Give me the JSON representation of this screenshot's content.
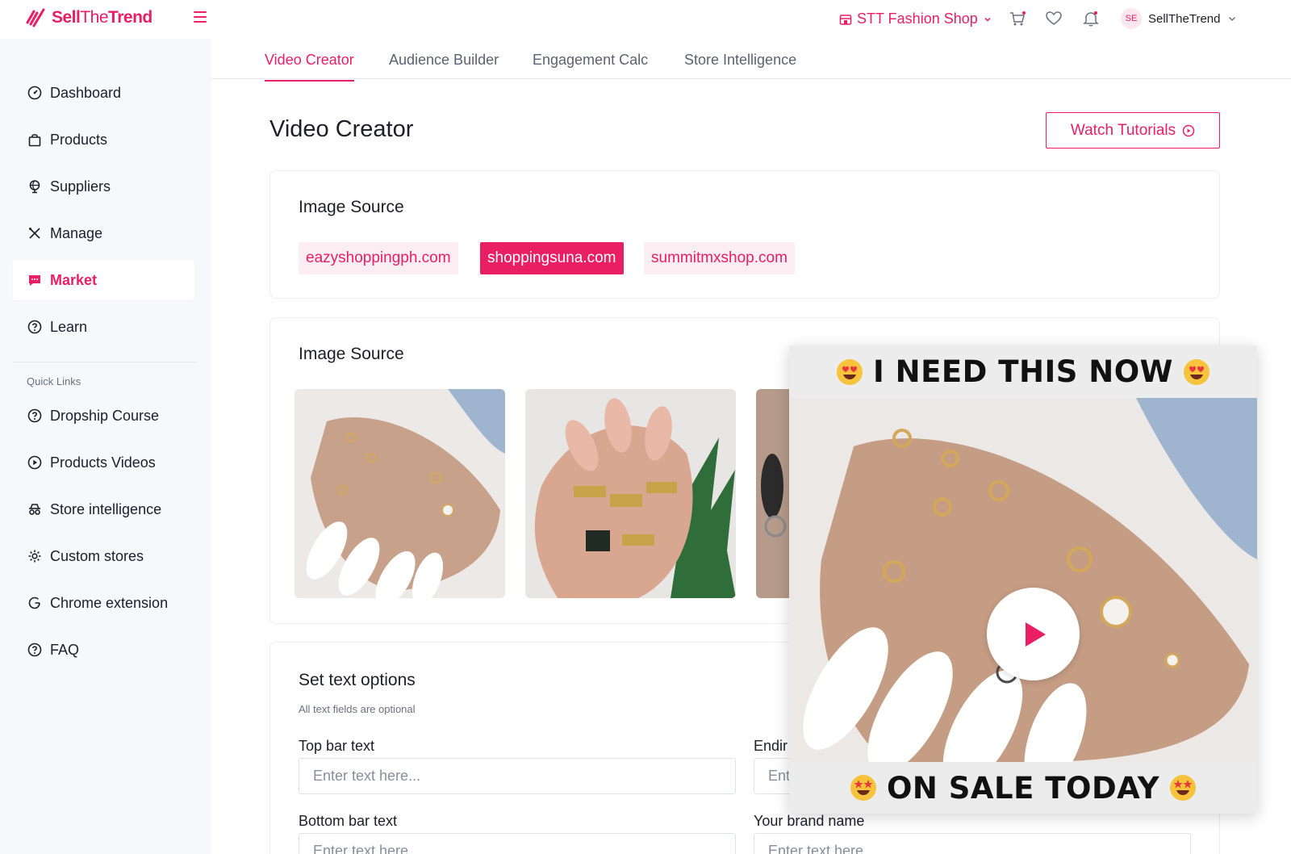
{
  "brand": {
    "logo_text_bold": "Sell",
    "logo_text_light": "The",
    "logo_text_end": "Trend",
    "accent": "#e91e63"
  },
  "sidebar": {
    "items": [
      {
        "label": "Dashboard",
        "icon": "dashboard-icon"
      },
      {
        "label": "Products",
        "icon": "bag-icon"
      },
      {
        "label": "Suppliers",
        "icon": "globe-icon"
      },
      {
        "label": "Manage",
        "icon": "tools-icon"
      },
      {
        "label": "Market",
        "icon": "chat-icon",
        "active": true
      },
      {
        "label": "Learn",
        "icon": "help-circle-icon"
      }
    ],
    "quick_links_label": "Quick Links",
    "quick_links": [
      {
        "label": "Dropship Course",
        "icon": "help-circle-icon"
      },
      {
        "label": "Products Videos",
        "icon": "play-circle-icon"
      },
      {
        "label": "Store intelligence",
        "icon": "spy-icon"
      },
      {
        "label": "Custom stores",
        "icon": "gear-icon"
      },
      {
        "label": "Chrome extension",
        "icon": "google-icon"
      },
      {
        "label": "FAQ",
        "icon": "help-circle-icon"
      }
    ]
  },
  "topbar": {
    "shop_label": "STT Fashion Shop",
    "user_initials": "SE",
    "user_name": "SellTheTrend"
  },
  "tabs": [
    {
      "label": "Video Creator",
      "active": true
    },
    {
      "label": "Audience Builder"
    },
    {
      "label": "Engagement Calc"
    },
    {
      "label": "Store Intelligence"
    }
  ],
  "main": {
    "title": "Video Creator",
    "watch_tutorials": "Watch Tutorials",
    "image_source_title": "Image Source",
    "sources": [
      {
        "label": "eazyshoppingph.com"
      },
      {
        "label": "shoppingsuna.com",
        "active": true
      },
      {
        "label": "summitmxshop.com"
      }
    ],
    "images_title": "Image Source",
    "text_options": {
      "title": "Set text options",
      "subtitle": "All text fields are optional",
      "top_bar_label": "Top bar text",
      "top_bar_placeholder": "Enter text here...",
      "ending_label": "Endir",
      "ending_placeholder": "Ent",
      "bottom_bar_label": "Bottom bar text",
      "bottom_bar_placeholder": "Enter text here...",
      "brand_label": "Your brand name",
      "brand_placeholder": "Enter text here..."
    }
  },
  "video_preview": {
    "top_text": "I NEED THIS NOW",
    "bottom_text": "ON SALE TODAY"
  }
}
